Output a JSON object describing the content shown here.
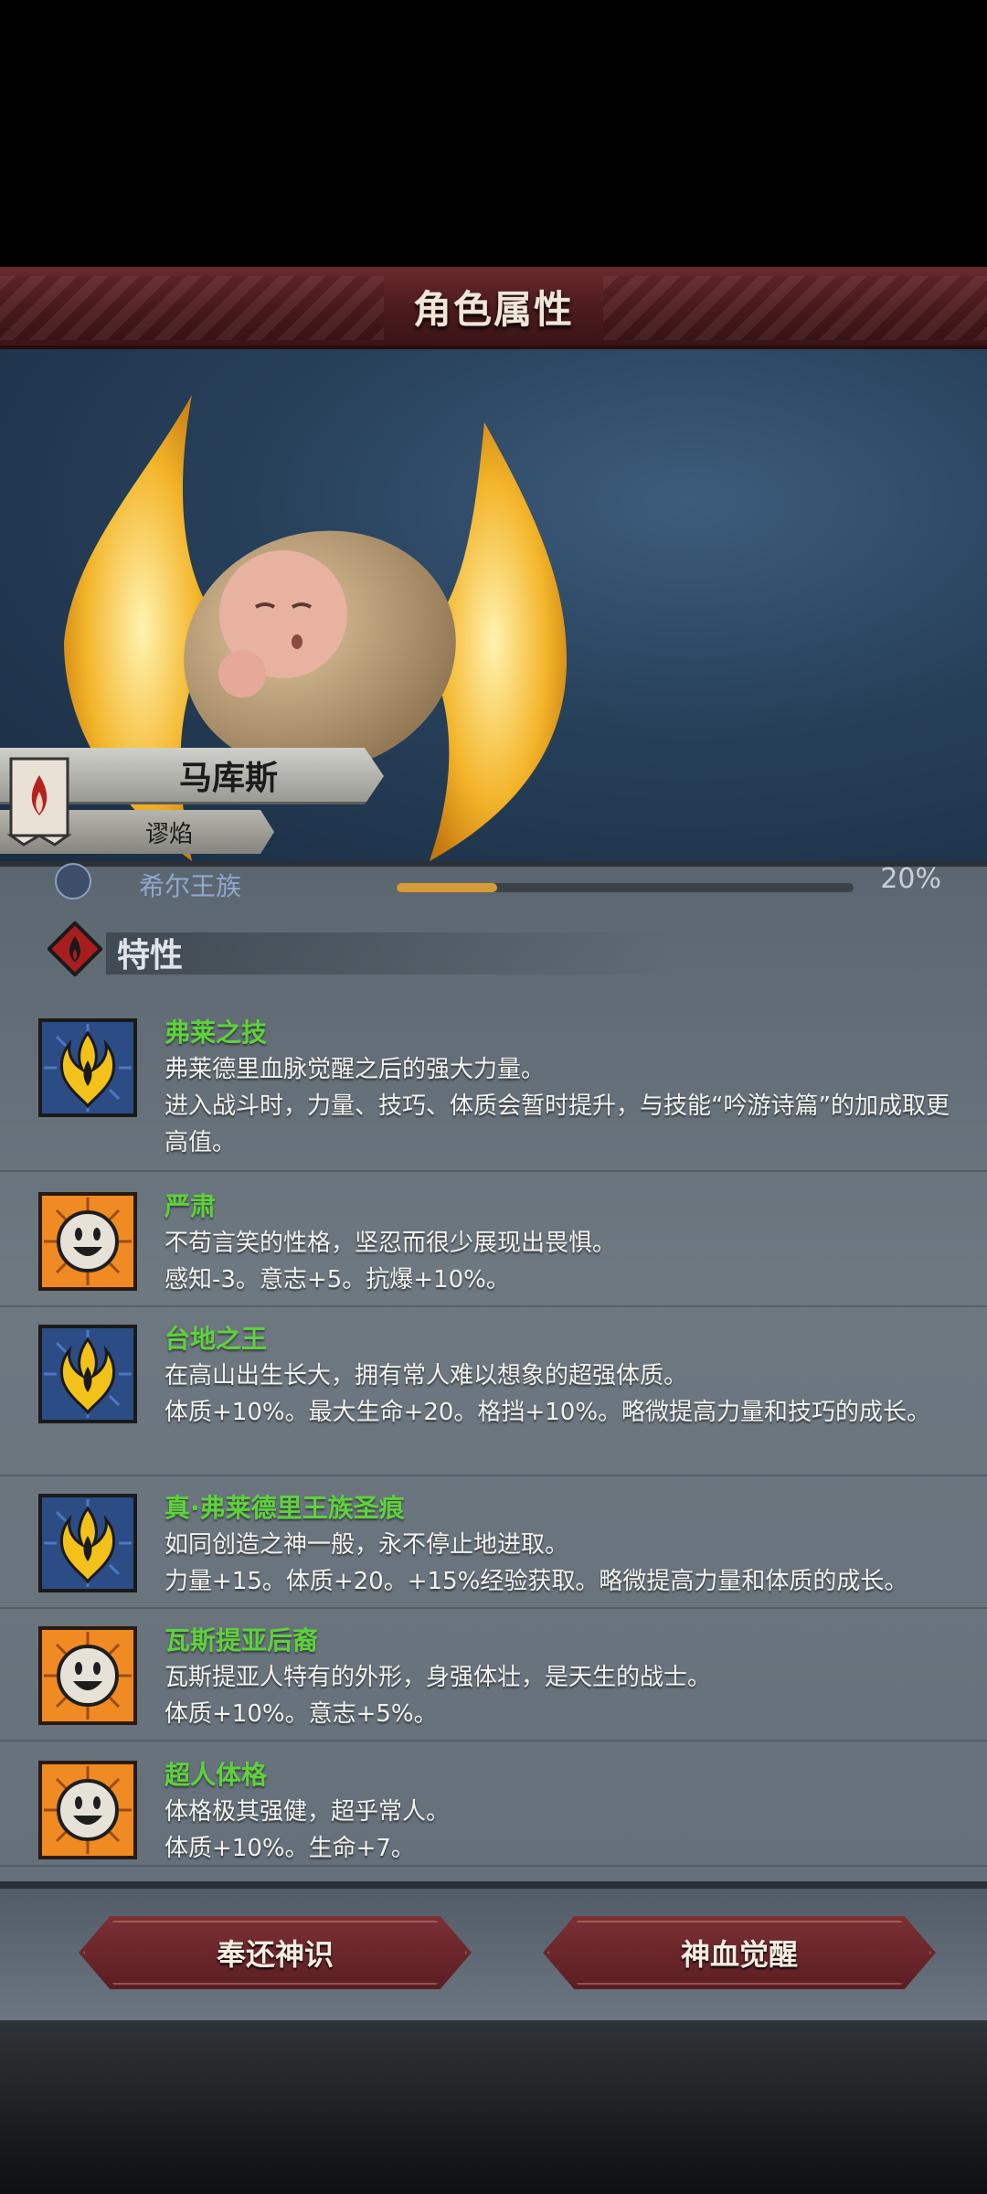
{
  "header": {
    "title": "角色属性"
  },
  "character": {
    "name": "马库斯",
    "class": "谬焰"
  },
  "partial_row": {
    "label": "希尔王族",
    "progress": 0.22,
    "percent": "20%"
  },
  "traits_section": {
    "label": "特性"
  },
  "traits": [
    {
      "name": "弗莱之技",
      "icon": "golden-flame-emblem-icon",
      "lines": [
        "弗莱德里血脉觉醒之后的强大力量。",
        "进入战斗时，力量、技巧、体质会暂时提升，与技能“吟游诗篇”的加成取更高值。"
      ]
    },
    {
      "name": "严肃",
      "icon": "smiley-face-icon",
      "lines": [
        "不苟言笑的性格，坚忍而很少展现出畏惧。",
        "感知-3。意志+5。抗爆+10%。"
      ]
    },
    {
      "name": "台地之王",
      "icon": "golden-flame-emblem-icon",
      "lines": [
        "在高山出生长大，拥有常人难以想象的超强体质。",
        "体质+10%。最大生命+20。格挡+10%。略微提高力量和技巧的成长。"
      ]
    },
    {
      "name": "真·弗莱德里王族圣痕",
      "icon": "golden-flame-emblem-icon",
      "lines": [
        "如同创造之神一般，永不停止地进取。",
        "力量+15。体质+20。+15%经验获取。略微提高力量和体质的成长。"
      ]
    },
    {
      "name": "瓦斯提亚后裔",
      "icon": "smiley-face-icon",
      "lines": [
        "瓦斯提亚人特有的外形，身强体壮，是天生的战士。",
        "体质+10%。意志+5%。"
      ]
    },
    {
      "name": "超人体格",
      "icon": "smiley-face-icon",
      "lines": [
        "体格极其强健，超乎常人。",
        "体质+10%。生命+7。"
      ]
    }
  ],
  "buttons": {
    "return": "奉还神识",
    "awaken": "神血觉醒"
  },
  "colors": {
    "trait_name": "#5fd13c",
    "header": "#5a2224",
    "button": "#6a2529"
  }
}
